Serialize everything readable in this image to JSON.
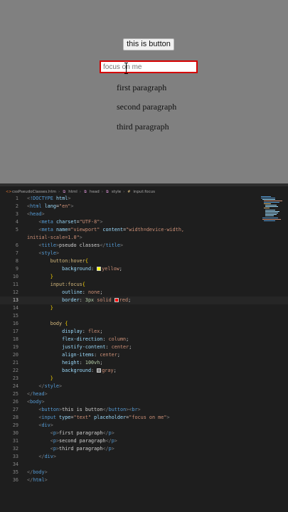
{
  "preview": {
    "button_label": "this is button",
    "input_placeholder": "focus on me",
    "paragraphs": [
      "first paragraph",
      "second paragraph",
      "third paragraph"
    ]
  },
  "breadcrumb": {
    "items": [
      "cssPseudoClasses.htm",
      "html",
      "head",
      "style",
      "input:focus"
    ],
    "icons": [
      "html-file-icon",
      "tag-icon",
      "tag-icon",
      "tag-icon",
      "selector-icon"
    ]
  },
  "editor": {
    "active_line": 13,
    "colors": {
      "yellow": "#ffff00",
      "red": "#ff0000",
      "gray": "#808080"
    }
  }
}
